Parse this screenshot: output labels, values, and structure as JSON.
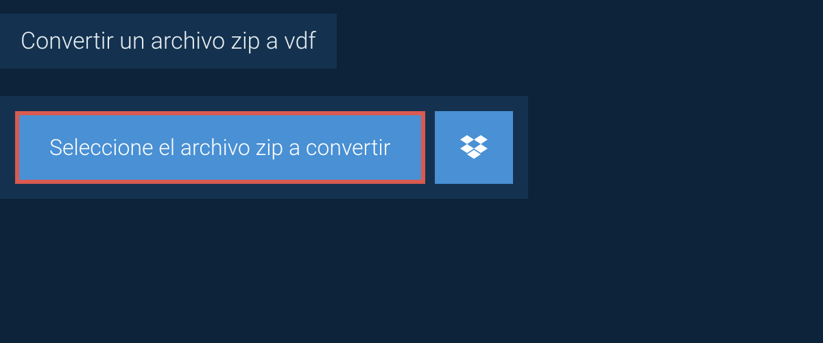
{
  "header": {
    "title": "Convertir un archivo zip a vdf"
  },
  "buttons": {
    "select_file_label": "Seleccione el archivo zip a convertir",
    "dropbox_icon": "dropbox"
  },
  "colors": {
    "background": "#0d2339",
    "panel": "#14324f",
    "button": "#4990d4",
    "highlight_border": "#d85a50",
    "text_light": "#e8eef3",
    "text_white": "#ffffff"
  }
}
